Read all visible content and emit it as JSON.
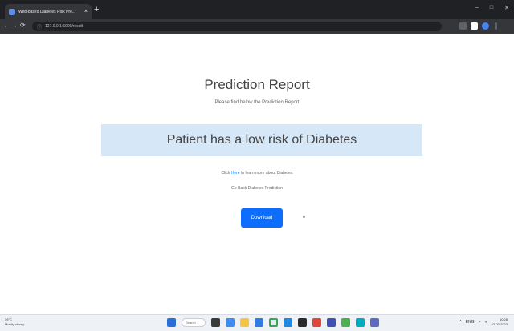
{
  "browser": {
    "tab_title": "Web-based Diabetes Risk Pre...",
    "tab_close": "×",
    "new_tab": "+",
    "url": "127.0.0.1:5000/result",
    "lock": "ⓘ",
    "back": "←",
    "forward": "→",
    "reload": "⟳",
    "home": "⌂",
    "window_minimize": "–",
    "window_maximize": "□",
    "window_close": "✕"
  },
  "page": {
    "title": "Prediction Report",
    "subtitle": "Please find below the Prediction Report",
    "result": "Patient has a low risk of Diabetes",
    "learn_prefix": "Click ",
    "learn_link": "Here",
    "learn_suffix": " to learn more about Diabetes",
    "back_link": "Go Back Diabetes Prediction",
    "download_label": "Download"
  },
  "taskbar": {
    "weather_temp": "29°C",
    "weather_desc": "Mostly cloudy",
    "search_label": "Search",
    "time": "10:28",
    "date": "23-03-2023",
    "lang": "ENG"
  },
  "colors": {
    "accent": "#0d6efd",
    "banner": "#d6e7f7",
    "link": "#1a73e8"
  }
}
